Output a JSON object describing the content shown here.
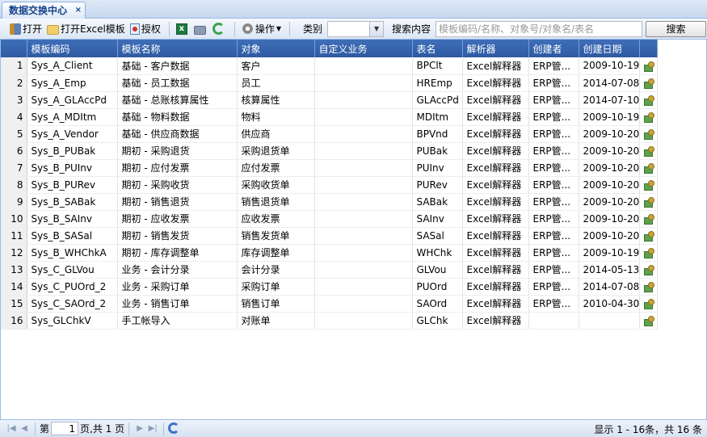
{
  "tab": {
    "title": "数据交换中心",
    "close": "×"
  },
  "toolbar": {
    "open": "打开",
    "open_excel": "打开Excel模板",
    "authorize": "授权",
    "operations": "操作",
    "category_label": "类别",
    "category_value": "",
    "search_label": "搜索内容",
    "search_placeholder": "模板编码/名称、对象号/对象名/表名",
    "search_button": "搜索"
  },
  "grid": {
    "columns": [
      "模板编码",
      "模板名称",
      "对象",
      "自定义业务",
      "表名",
      "解析器",
      "创建者",
      "创建日期"
    ],
    "rows": [
      {
        "n": "1",
        "code": "Sys_A_Client",
        "name": "基础 - 客户数据",
        "object": "客户",
        "custom": "",
        "table": "BPClt",
        "parser": "Excel解释器",
        "creator": "ERP管...",
        "date": "2009-10-19"
      },
      {
        "n": "2",
        "code": "Sys_A_Emp",
        "name": "基础 - 员工数据",
        "object": "员工",
        "custom": "",
        "table": "HREmp",
        "parser": "Excel解释器",
        "creator": "ERP管...",
        "date": "2014-07-08"
      },
      {
        "n": "3",
        "code": "Sys_A_GLAccPd",
        "name": "基础 - 总账核算属性",
        "object": "核算属性",
        "custom": "",
        "table": "GLAccPd",
        "parser": "Excel解释器",
        "creator": "ERP管...",
        "date": "2014-07-10"
      },
      {
        "n": "4",
        "code": "Sys_A_MDItm",
        "name": "基础 - 物料数据",
        "object": "物料",
        "custom": "",
        "table": "MDItm",
        "parser": "Excel解释器",
        "creator": "ERP管...",
        "date": "2009-10-19"
      },
      {
        "n": "5",
        "code": "Sys_A_Vendor",
        "name": "基础 - 供应商数据",
        "object": "供应商",
        "custom": "",
        "table": "BPVnd",
        "parser": "Excel解释器",
        "creator": "ERP管...",
        "date": "2009-10-20"
      },
      {
        "n": "6",
        "code": "Sys_B_PUBak",
        "name": "期初 - 采购退货",
        "object": "采购退货单",
        "custom": "",
        "table": "PUBak",
        "parser": "Excel解释器",
        "creator": "ERP管...",
        "date": "2009-10-20"
      },
      {
        "n": "7",
        "code": "Sys_B_PUInv",
        "name": "期初 - 应付发票",
        "object": "应付发票",
        "custom": "",
        "table": "PUInv",
        "parser": "Excel解释器",
        "creator": "ERP管...",
        "date": "2009-10-20"
      },
      {
        "n": "8",
        "code": "Sys_B_PURev",
        "name": "期初 - 采购收货",
        "object": "采购收货单",
        "custom": "",
        "table": "PURev",
        "parser": "Excel解释器",
        "creator": "ERP管...",
        "date": "2009-10-20"
      },
      {
        "n": "9",
        "code": "Sys_B_SABak",
        "name": "期初 - 销售退货",
        "object": "销售退货单",
        "custom": "",
        "table": "SABak",
        "parser": "Excel解释器",
        "creator": "ERP管...",
        "date": "2009-10-20"
      },
      {
        "n": "10",
        "code": "Sys_B_SAInv",
        "name": "期初 - 应收发票",
        "object": "应收发票",
        "custom": "",
        "table": "SAInv",
        "parser": "Excel解释器",
        "creator": "ERP管...",
        "date": "2009-10-20"
      },
      {
        "n": "11",
        "code": "Sys_B_SASal",
        "name": "期初 - 销售发货",
        "object": "销售发货单",
        "custom": "",
        "table": "SASal",
        "parser": "Excel解释器",
        "creator": "ERP管...",
        "date": "2009-10-20"
      },
      {
        "n": "12",
        "code": "Sys_B_WHChkA",
        "name": "期初 - 库存调整单",
        "object": "库存调整单",
        "custom": "",
        "table": "WHChk",
        "parser": "Excel解释器",
        "creator": "ERP管...",
        "date": "2009-10-19"
      },
      {
        "n": "13",
        "code": "Sys_C_GLVou",
        "name": "业务 - 会计分录",
        "object": "会计分录",
        "custom": "",
        "table": "GLVou",
        "parser": "Excel解释器",
        "creator": "ERP管...",
        "date": "2014-05-13"
      },
      {
        "n": "14",
        "code": "Sys_C_PUOrd_2",
        "name": "业务 - 采购订单",
        "object": "采购订单",
        "custom": "",
        "table": "PUOrd",
        "parser": "Excel解释器",
        "creator": "ERP管...",
        "date": "2014-07-08"
      },
      {
        "n": "15",
        "code": "Sys_C_SAOrd_2",
        "name": "业务 - 销售订单",
        "object": "销售订单",
        "custom": "",
        "table": "SAOrd",
        "parser": "Excel解释器",
        "creator": "ERP管...",
        "date": "2010-04-30"
      },
      {
        "n": "16",
        "code": "Sys_GLChkV",
        "name": "手工帐导入",
        "object": "对账单",
        "custom": "",
        "table": "GLChk",
        "parser": "Excel解释器",
        "creator": "",
        "date": ""
      }
    ]
  },
  "pager": {
    "page_prefix": "第",
    "page_value": "1",
    "page_suffix": "页,共 1 页",
    "info": "显示 1 - 16条，共 16 条"
  }
}
